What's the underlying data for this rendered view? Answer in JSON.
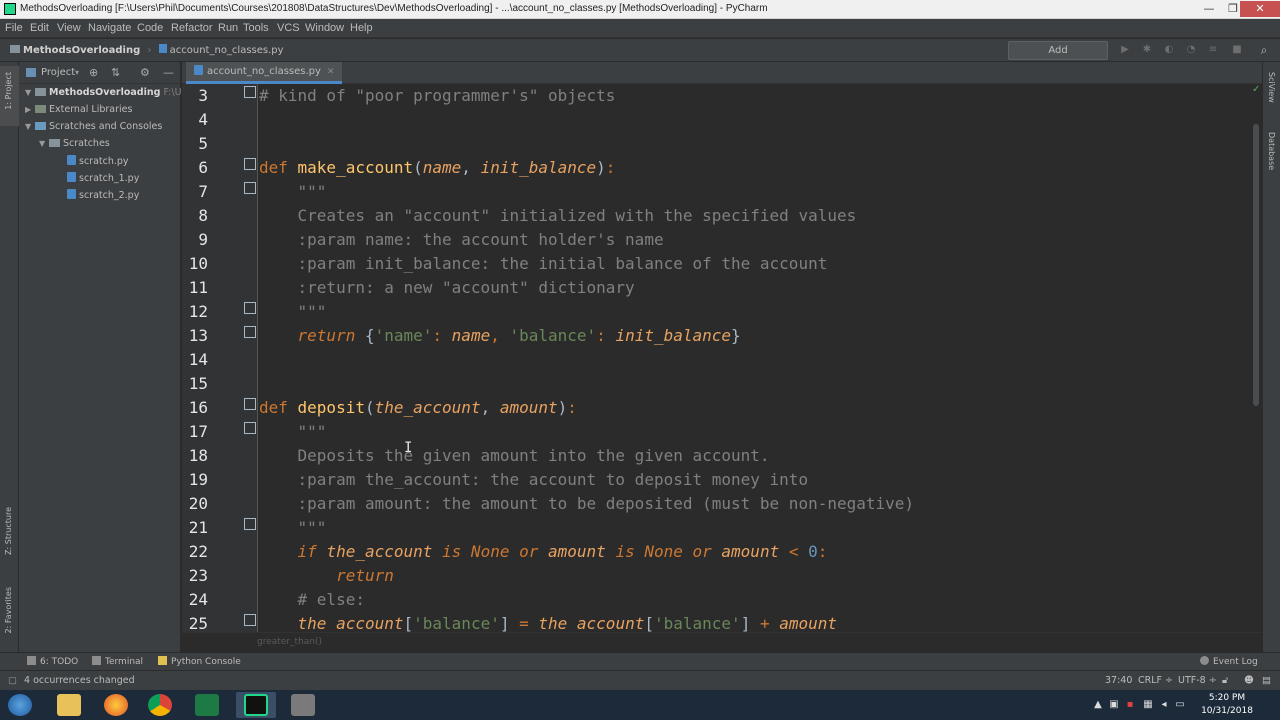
{
  "window": {
    "title": "MethodsOverloading [F:\\Users\\Phil\\Documents\\Courses\\201808\\DataStructures\\Dev\\MethodsOverloading] - ...\\account_no_classes.py [MethodsOverloading] - PyCharm",
    "minimize": "—",
    "maximize": "❐",
    "close": "✕"
  },
  "menu": [
    "File",
    "Edit",
    "View",
    "Navigate",
    "Code",
    "Refactor",
    "Run",
    "Tools",
    "VCS",
    "Window",
    "Help"
  ],
  "navbar": {
    "project": "MethodsOverloading",
    "file": "account_no_classes.py",
    "add_configuration": "Add Configuration..."
  },
  "leftstrip": {
    "project_label": "1: Project",
    "structure_label": "Z: Structure",
    "favorites_label": "2: Favorites"
  },
  "rightstrip": {
    "sciview_label": "SciView",
    "database_label": "Database"
  },
  "project_panel": {
    "title": "Project",
    "tree": [
      {
        "label": "MethodsOverloading",
        "path": "F:\\Us",
        "indent": 0,
        "kind": "folder",
        "expanded": true,
        "bold": true
      },
      {
        "label": "External Libraries",
        "indent": 0,
        "kind": "lib",
        "expanded": false,
        "bold": false
      },
      {
        "label": "Scratches and Consoles",
        "indent": 0,
        "kind": "folder",
        "expanded": true,
        "bold": false
      },
      {
        "label": "Scratches",
        "indent": 1,
        "kind": "folder",
        "expanded": true,
        "bold": false
      },
      {
        "label": "scratch.py",
        "indent": 2,
        "kind": "py",
        "bold": false
      },
      {
        "label": "scratch_1.py",
        "indent": 2,
        "kind": "py",
        "bold": false
      },
      {
        "label": "scratch_2.py",
        "indent": 2,
        "kind": "py",
        "bold": false
      }
    ]
  },
  "editor": {
    "tab": "account_no_classes.py",
    "tab_close": "✕",
    "line_numbers": [
      "3",
      "4",
      "5",
      "6",
      "7",
      "8",
      "9",
      "10",
      "11",
      "12",
      "13",
      "14",
      "15",
      "16",
      "17",
      "18",
      "19",
      "20",
      "21",
      "22",
      "23",
      "24",
      "25"
    ],
    "hint": "greater_than()"
  },
  "bottom_tools": [
    {
      "label": "6: TODO"
    },
    {
      "label": "Terminal"
    },
    {
      "label": "Python Console"
    },
    {
      "label": "Event Log"
    }
  ],
  "status": {
    "message": "4 occurrences changed",
    "position": "37:40",
    "line_sep": "CRLF ÷",
    "encoding": "UTF-8 ÷"
  },
  "taskbar": {
    "time": "5:20 PM",
    "date": "10/31/2018"
  },
  "colors": {
    "keyword": "#cc7832",
    "function": "#ffc66d",
    "param": "#e8a261",
    "string": "#6a8759",
    "comment": "#808080",
    "number": "#6897bb"
  }
}
